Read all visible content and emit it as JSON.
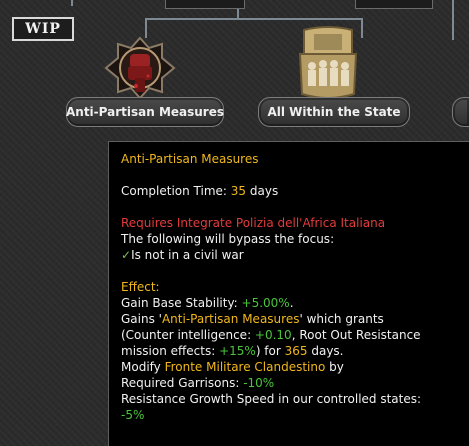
{
  "badge": {
    "label": "WIP"
  },
  "focuses": [
    {
      "label": "Anti-Partisan Measures",
      "icon": "bloody-fist-icon"
    },
    {
      "label": "All Within the State",
      "icon": "fascist-crowd-icon"
    }
  ],
  "tooltip": {
    "title": "Anti-Partisan Measures",
    "completion_prefix": "Completion Time: ",
    "completion_value": "35",
    "completion_suffix": " days",
    "requires": "Requires Integrate Polizia dell'Africa Italiana",
    "bypass_intro": "The following will bypass the focus:",
    "bypass_condition": "Is not in a civil war",
    "effect_heading": "Effect:",
    "stability_prefix": "Gain Base Stability: ",
    "stability_value": "+5.00%",
    "stability_suffix": ".",
    "gains_prefix": "Gains '",
    "gains_name": "Anti-Partisan Measures",
    "gains_suffix": "' which grants",
    "ci_prefix": "(Counter intelligence: ",
    "ci_value": "+0.10",
    "ci_suffix": ", Root Out Resistance",
    "mission_prefix": "mission effects: ",
    "mission_value": "+15%",
    "mission_mid": ") for ",
    "mission_days": "365",
    "mission_suffix": " days.",
    "modify_prefix": "Modify ",
    "modify_name": "Fronte Militare Clandestino",
    "modify_suffix": " by",
    "garrison_prefix": "Required Garrisons: ",
    "garrison_value": "-10%",
    "resistance_line": "Resistance Growth Speed in our controlled  states:",
    "resistance_value": "-5%"
  },
  "colors": {
    "highlight": "#f0b81c",
    "requirement": "#e33b3b",
    "positive": "#4ac43a",
    "tooltip_bg": "#000000"
  }
}
